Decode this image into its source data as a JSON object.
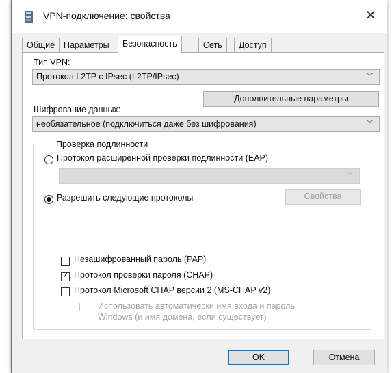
{
  "window": {
    "title": "VPN-подключение: свойства",
    "close_glyph": "✕"
  },
  "tabs": [
    {
      "label": "Общие",
      "active": false
    },
    {
      "label": "Параметры",
      "active": false
    },
    {
      "label": "Безопасность",
      "active": true
    },
    {
      "label": "Сеть",
      "active": false
    },
    {
      "label": "Доступ",
      "active": false
    }
  ],
  "vpn_type": {
    "label": "Тип VPN:",
    "value": "Протокол L2TP с IPsec (L2TP/IPsec)"
  },
  "advanced_button": "Дополнительные параметры",
  "encryption": {
    "label": "Шифрование данных:",
    "value": "необязательное (подключиться даже без шифрования)"
  },
  "auth": {
    "legend": "Проверка подлинности",
    "eap_radio": "Протокол расширенной проверки подлинности (EAP)",
    "eap_selected": false,
    "eap_combo_value": "",
    "allow_radio": "Разрешить следующие протоколы",
    "allow_selected": true,
    "properties_button": "Свойства",
    "protocols": [
      {
        "label": "Незашифрованный пароль (PAP)",
        "checked": false,
        "enabled": true
      },
      {
        "label": "Протокол проверки пароля (CHAP)",
        "checked": true,
        "enabled": true
      },
      {
        "label": "Протокол Microsoft CHAP версии 2 (MS-CHAP v2)",
        "checked": false,
        "enabled": true
      }
    ],
    "auto_login": {
      "line1": "Использовать автоматически имя входа и пароль",
      "line2": "Windows (и имя домена, если существует)",
      "checked": false,
      "enabled": false
    }
  },
  "footer": {
    "ok": "OK",
    "cancel": "Отмена"
  },
  "icons": {
    "title": "network-icon",
    "chevron": "chevron-down-icon",
    "close": "close-icon"
  },
  "colors": {
    "accent": "#0078d7",
    "dialog_bg": "#f0f0f0",
    "border": "#adadad"
  }
}
